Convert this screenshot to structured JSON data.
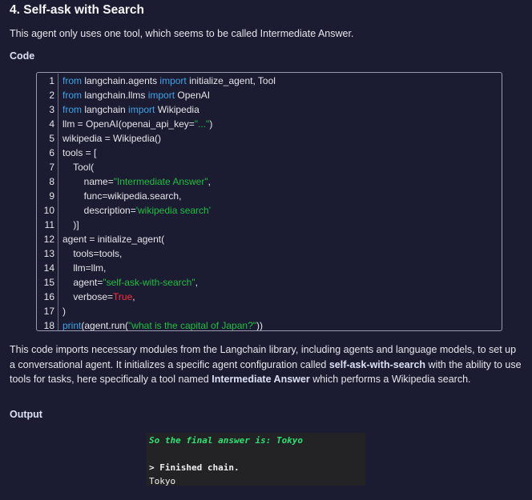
{
  "section": {
    "heading": "4. Self-ask with Search",
    "intro": "This agent only uses one tool, which seems to be called Intermediate Answer.",
    "code_label": "Code",
    "output_label": "Output"
  },
  "code_lines": [
    {
      "n": "1",
      "tokens": [
        {
          "t": "from",
          "c": "kw"
        },
        {
          "t": " langchain.agents ",
          "c": "plain"
        },
        {
          "t": "import",
          "c": "kw"
        },
        {
          "t": " initialize_agent, Tool",
          "c": "plain"
        }
      ]
    },
    {
      "n": "2",
      "tokens": [
        {
          "t": "from",
          "c": "kw"
        },
        {
          "t": " langchain.llms ",
          "c": "plain"
        },
        {
          "t": "import",
          "c": "kw"
        },
        {
          "t": " OpenAI",
          "c": "plain"
        }
      ]
    },
    {
      "n": "3",
      "tokens": [
        {
          "t": "from",
          "c": "kw"
        },
        {
          "t": " langchain ",
          "c": "plain"
        },
        {
          "t": "import",
          "c": "kw"
        },
        {
          "t": " Wikipedia",
          "c": "plain"
        }
      ]
    },
    {
      "n": "4",
      "tokens": [
        {
          "t": "llm = OpenAI(openai_api_key=",
          "c": "plain"
        },
        {
          "t": "\"...\"",
          "c": "str"
        },
        {
          "t": ")",
          "c": "plain"
        }
      ]
    },
    {
      "n": "5",
      "tokens": [
        {
          "t": "wikipedia = Wikipedia()",
          "c": "plain"
        }
      ]
    },
    {
      "n": "6",
      "tokens": [
        {
          "t": "tools = [",
          "c": "plain"
        }
      ]
    },
    {
      "n": "7",
      "tokens": [
        {
          "t": "    Tool(",
          "c": "plain"
        }
      ]
    },
    {
      "n": "8",
      "tokens": [
        {
          "t": "        name=",
          "c": "plain"
        },
        {
          "t": "\"Intermediate Answer\"",
          "c": "str"
        },
        {
          "t": ",",
          "c": "plain"
        }
      ]
    },
    {
      "n": "9",
      "tokens": [
        {
          "t": "        func=wikipedia.search,",
          "c": "plain"
        }
      ]
    },
    {
      "n": "10",
      "tokens": [
        {
          "t": "        description=",
          "c": "plain"
        },
        {
          "t": "'wikipedia search'",
          "c": "str"
        }
      ]
    },
    {
      "n": "11",
      "tokens": [
        {
          "t": "    )]",
          "c": "plain"
        }
      ]
    },
    {
      "n": "12",
      "tokens": [
        {
          "t": "agent = initialize_agent(",
          "c": "plain"
        }
      ]
    },
    {
      "n": "13",
      "tokens": [
        {
          "t": "    tools=tools,",
          "c": "plain"
        }
      ]
    },
    {
      "n": "14",
      "tokens": [
        {
          "t": "    llm=llm,",
          "c": "plain"
        }
      ]
    },
    {
      "n": "15",
      "tokens": [
        {
          "t": "    agent=",
          "c": "plain"
        },
        {
          "t": "\"self-ask-with-search\"",
          "c": "str"
        },
        {
          "t": ",",
          "c": "plain"
        }
      ]
    },
    {
      "n": "16",
      "tokens": [
        {
          "t": "    verbose=",
          "c": "plain"
        },
        {
          "t": "True",
          "c": "kw2"
        },
        {
          "t": ",",
          "c": "plain"
        }
      ]
    },
    {
      "n": "17",
      "tokens": [
        {
          "t": ")",
          "c": "plain"
        }
      ]
    },
    {
      "n": "18",
      "tokens": [
        {
          "t": "print",
          "c": "kw"
        },
        {
          "t": "(agent.run(",
          "c": "plain"
        },
        {
          "t": "\"what is the capital of Japan?\"",
          "c": "str"
        },
        {
          "t": "))",
          "c": "plain"
        }
      ]
    }
  ],
  "explanation": {
    "part1": "This code imports necessary modules from the Langchain library, including agents and language models, to set up a conversational agent. It initializes a specific agent configuration called ",
    "bold1": "self-ask-with-search",
    "part2": " with the ability to use tools for tasks, here specifically a tool named ",
    "bold2": "Intermediate Answer",
    "part3": " which performs a Wikipedia search."
  },
  "terminal": {
    "line1": "So the final answer is: Tokyo",
    "line2": "",
    "line3": "> Finished chain.",
    "line4": "Tokyo"
  },
  "colors": {
    "background": "#1b1b32",
    "keyword": "#3fa4e6",
    "string": "#1fbf3f",
    "constant": "#ff2f3f",
    "terminal_bg": "#232325",
    "terminal_green": "#2ee072"
  }
}
